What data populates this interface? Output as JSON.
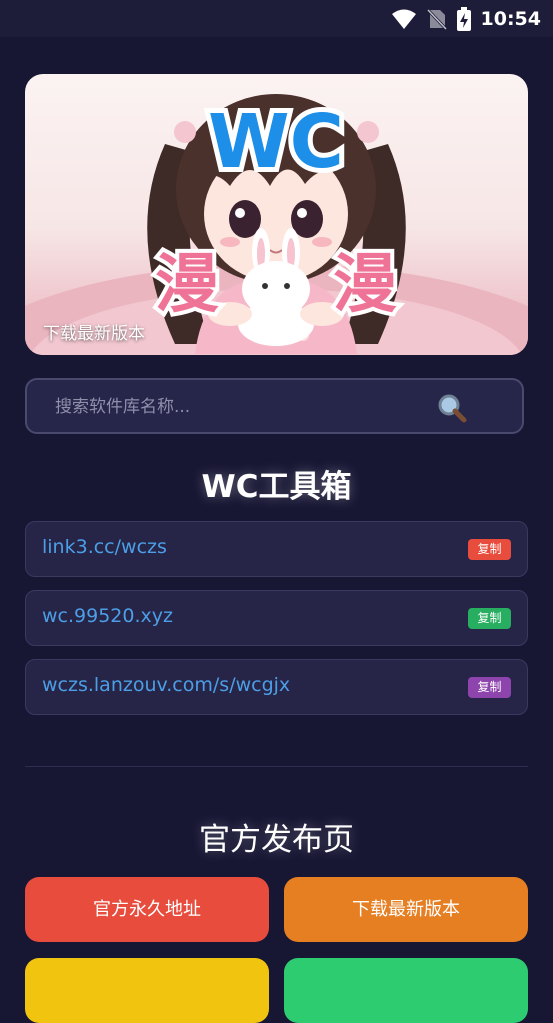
{
  "status_bar": {
    "time": "10:54",
    "icons": [
      "wifi-icon",
      "no-sim-icon",
      "battery-charging-icon"
    ]
  },
  "banner": {
    "caption": "下载最新版本",
    "logo_text": "WC",
    "side_text": "漫",
    "slide_count": 3,
    "active_slide": 2
  },
  "search": {
    "placeholder": "搜索软件库名称...",
    "value": ""
  },
  "toolbox": {
    "title": "WC工具箱",
    "links": [
      {
        "url": "link3.cc/wczs",
        "copy_label": "复制",
        "badge_color": "#e74c3c"
      },
      {
        "url": "wc.99520.xyz",
        "copy_label": "复制",
        "badge_color": "#27ae60"
      },
      {
        "url": "wczs.lanzouv.com/s/wcgjx",
        "copy_label": "复制",
        "badge_color": "#8e44ad"
      }
    ]
  },
  "official": {
    "title": "官方发布页",
    "buttons": [
      {
        "label": "官方永久地址",
        "color": "#e74c3c"
      },
      {
        "label": "下载最新版本",
        "color": "#e67e22"
      },
      {
        "label": "",
        "color": "#f1c40f"
      },
      {
        "label": "",
        "color": "#2ecc71"
      }
    ]
  }
}
